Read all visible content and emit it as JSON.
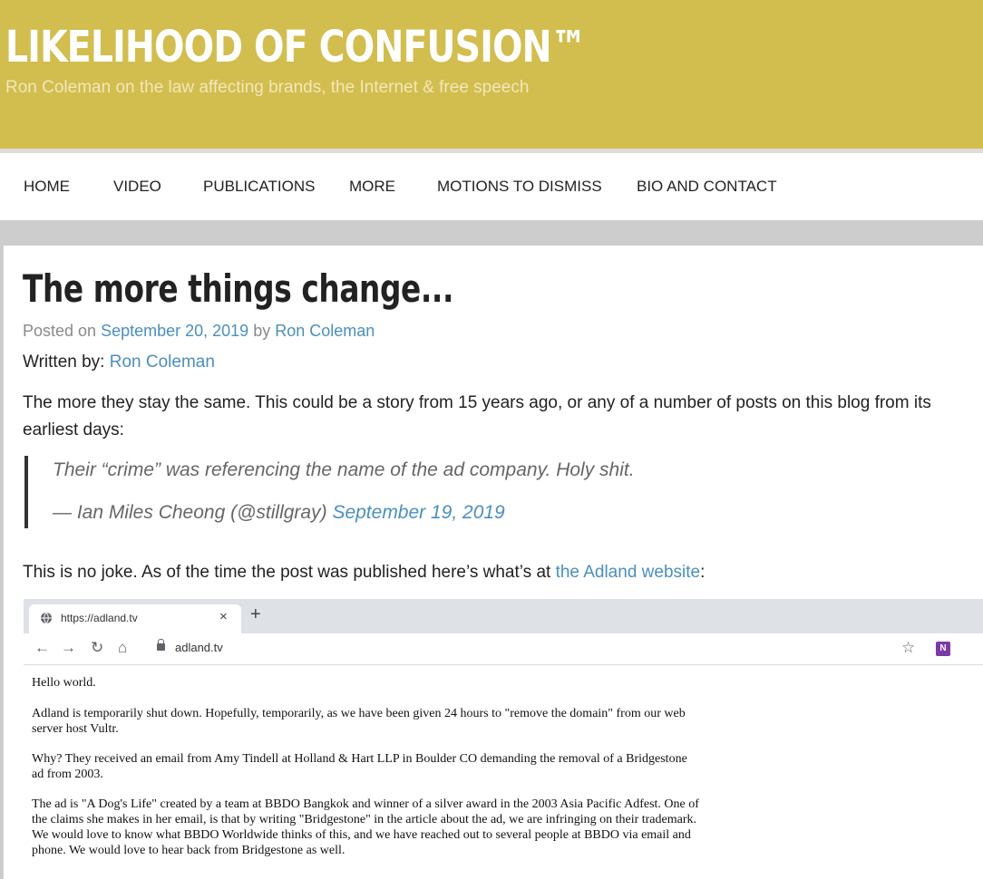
{
  "site": {
    "title": "LIKELIHOOD OF CONFUSION™",
    "tagline": "Ron Coleman on the law affecting brands, the Internet & free speech"
  },
  "nav": {
    "items": [
      "HOME",
      "VIDEO",
      "PUBLICATIONS",
      "MORE",
      "MOTIONS TO DISMISS",
      "BIO AND CONTACT"
    ]
  },
  "post": {
    "title": "The more things change...",
    "posted_on_label": "Posted on",
    "date": "September 20, 2019",
    "by_label": "by",
    "author": "Ron Coleman",
    "written_by_label": "Written by:",
    "written_by_author": "Ron Coleman",
    "intro": "The more they stay the same. This could be a story from 15 years ago, or any of a number of posts on this blog from its earliest days:",
    "quote": {
      "text": "Their “crime” was referencing the name of the ad company. Holy shit.",
      "cite": "— Ian Miles Cheong (@stillgray)",
      "date_link": "September 19, 2019"
    },
    "para2_prefix": "This is no joke. As of the time the post was published here’s what’s at",
    "para2_link": "the Adland website",
    "para2_suffix": ":"
  },
  "screenshot": {
    "tab_url": "https://adland.tv",
    "tab_close": "×",
    "new_tab": "+",
    "address": "adland.tv",
    "icons": [
      "back-icon",
      "forward-icon",
      "reload-icon",
      "home-icon",
      "lock-icon",
      "star-icon",
      "onenote-icon"
    ],
    "onenote_badge": "N",
    "page_lines": [
      "Hello world.",
      "Adland is temporarily shut down. Hopefully, temporarily, as we have been given 24 hours to \"remove the domain\" from our web",
      "server host Vultr.",
      "Why? They received an email from Amy Tindell at Holland & Hart LLP in Boulder CO demanding the removal of a Bridgestone",
      "ad from 2003.",
      "The ad is \"A Dog's Life\" created by a team at BBDO Bangkok and winner of a silver award in the 2003 Asia Pacific Adfest. One of",
      "the claims she makes in her email, is that by writing \"Bridgestone\" in the article about the ad, we are infringing on their trademark.",
      "We would love to know what BBDO Worldwide thinks of this, and we have reached out to several people at BBDO via email and",
      "phone. We would love to hear back from Bridgestone as well."
    ]
  }
}
